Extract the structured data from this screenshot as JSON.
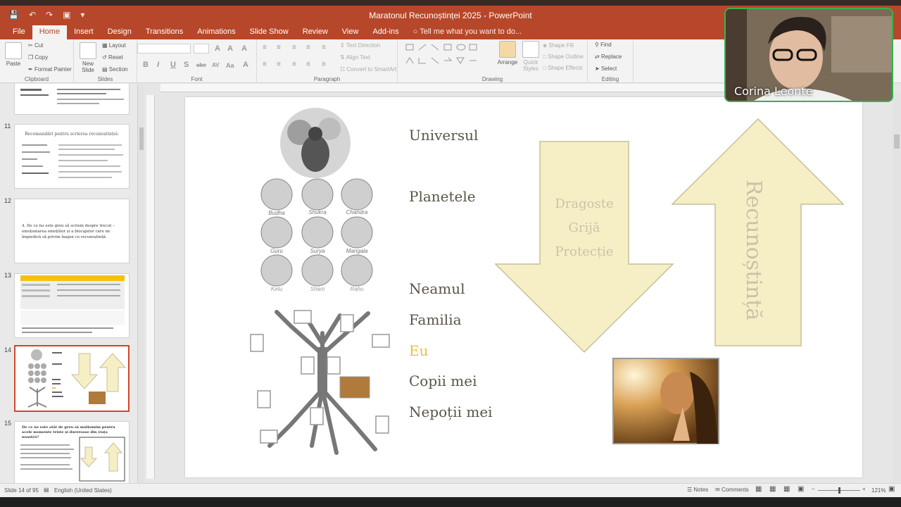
{
  "app": {
    "title": "Maratonul Recunoștinței 2025 - PowerPoint"
  },
  "tabs": [
    {
      "label": "File"
    },
    {
      "label": "Home"
    },
    {
      "label": "Insert"
    },
    {
      "label": "Design"
    },
    {
      "label": "Transitions"
    },
    {
      "label": "Animations"
    },
    {
      "label": "Slide Show"
    },
    {
      "label": "Review"
    },
    {
      "label": "View"
    },
    {
      "label": "Add-ins"
    }
  ],
  "tell_me": "Tell me what you want to do...",
  "ribbon": {
    "clipboard": {
      "label": "Clipboard",
      "paste": "Paste",
      "cut": "Cut",
      "copy": "Copy",
      "format_painter": "Format Painter"
    },
    "slides": {
      "label": "Slides",
      "new_slide": "New Slide",
      "layout": "Layout",
      "reset": "Reset",
      "section": "Section"
    },
    "font": {
      "label": "Font",
      "bold": "B",
      "italic": "I",
      "underline": "U",
      "strike": "S",
      "abc": "abc",
      "spacing": "AV",
      "case": "Aa",
      "color": "A"
    },
    "paragraph": {
      "label": "Paragraph",
      "text_direction": "Text Direction",
      "align_text": "Align Text",
      "convert_smartart": "Convert to SmartArt"
    },
    "drawing": {
      "label": "Drawing",
      "arrange": "Arrange",
      "quick_styles": "Quick Styles",
      "shape_fill": "Shape Fill",
      "shape_outline": "Shape Outline",
      "shape_effects": "Shape Effects"
    },
    "editing": {
      "label": "Editing",
      "find": "Find",
      "replace": "Replace",
      "select": "Select"
    }
  },
  "thumbnails": [
    {
      "num": "11",
      "title": "Recomandări pentru scrierea recunoștinței:"
    },
    {
      "num": "12",
      "title": "4. De ce nu este greu să scriem despre trecut – emoționarea emoțiilor și a blocajelor care ne împiedică să privim înapoi cu recunoștință."
    },
    {
      "num": "13",
      "title": ""
    },
    {
      "num": "14",
      "title": ""
    },
    {
      "num": "15",
      "title": "De ce ne este atât de greu să mulțumim pentru acele momente triste și dureroase din viața noastră?"
    }
  ],
  "slide": {
    "labels": {
      "universul": "Universul",
      "planetele": "Planetele",
      "neamul": "Neamul",
      "familia": "Familia",
      "eu": "Eu",
      "copii": "Copii mei",
      "nepotii": "Nepoții mei"
    },
    "planets": [
      "Budha",
      "Shukra",
      "Chandra",
      "Guru",
      "Surya",
      "Mangala",
      "Ketu",
      "Shani",
      "Rahu"
    ],
    "down_arrow": [
      "Dragoste",
      "Grijă",
      "Protecție"
    ],
    "up_arrow": "Recunoștință"
  },
  "status": {
    "slide_of": "Slide 14 of 95",
    "language": "English (United States)",
    "notes": "Notes",
    "comments": "Comments",
    "zoom": "121%"
  },
  "webcam": {
    "name": "Corina Leonte"
  },
  "colors": {
    "accent": "#b7472a",
    "arrow_fill": "#f6efc6",
    "arrow_stroke": "#c7bf98",
    "eu_label": "#e6c23a",
    "webcam_border": "#37b24d"
  }
}
